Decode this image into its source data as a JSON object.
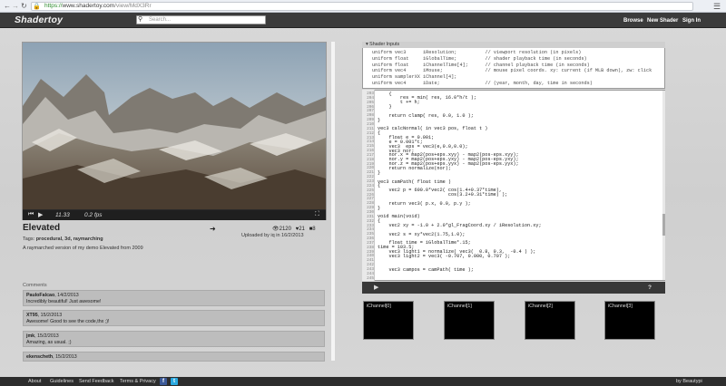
{
  "browser": {
    "url_secure": "https://",
    "url_host": "www.shadertoy.com",
    "url_path": "/view/MdX3Rr"
  },
  "header": {
    "logo": "Shadertoy",
    "search_placeholder": "Search...",
    "links": [
      "Browse",
      "New Shader",
      "Sign In"
    ]
  },
  "player": {
    "time": "11.33",
    "fps": "0.2 fps"
  },
  "shader": {
    "title": "Elevated",
    "views": "2120",
    "likes": "21",
    "comments_count": "8",
    "tags_label": "Tags:",
    "tags": "procedural, 3d, raymarching",
    "uploaded": "Uploaded by iq in 16/2/2013",
    "description": "A raymarched version of my demo Elevated from 2009"
  },
  "comments": {
    "label": "Comments",
    "items": [
      {
        "user": "PauloFalcao",
        "date": "14/2/2013",
        "text": "Incredibly beautiful! Just awesome!"
      },
      {
        "user": "XT95",
        "date": "15/2/2013",
        "text": "Awesome! Good to see the code,thx ;)!"
      },
      {
        "user": "jmk",
        "date": "15/2/2013",
        "text": "Amazing, as usual. ;)"
      },
      {
        "user": "ekenscheth",
        "date": "15/2/2013",
        "text": ""
      }
    ]
  },
  "inputs": {
    "title": "Shader Inputs",
    "lines": [
      "uniform vec3      iResolution;          // viewport resolution (in pixels)",
      "uniform float     iGlobalTime;          // shader playback time (in seconds)",
      "uniform float     iChannelTime[4];      // channel playback time (in seconds)",
      "uniform vec4      iMouse;               // mouse pixel coords. xy: current (if MLB down), zw: click",
      "uniform samplerXX iChannel[4];",
      "uniform vec4      iDate;                // (year, month, day, time in seconds)"
    ]
  },
  "editor": {
    "line_numbers": [
      "203",
      "204",
      "205",
      "206",
      "207",
      "208",
      "209",
      "210",
      "211",
      "212",
      "213",
      "214",
      "215",
      "216",
      "217",
      "218",
      "219",
      "220",
      "221",
      "222",
      "223",
      "224",
      "225",
      "226",
      "227",
      "228",
      "229",
      "230",
      "231",
      "232",
      "233",
      "234",
      "235",
      "236",
      "237",
      "238",
      "239",
      "240",
      "241",
      "242",
      "243",
      "244",
      "245"
    ],
    "code": [
      "    {",
      "        res = min( res, 16.0*h/t );",
      "        t += h;",
      "    }",
      "",
      "    return clamp( res, 0.0, 1.0 );",
      "}",
      "",
      "vec3 calcNormal( in vec3 pos, float t )",
      "{",
      "    float e = 0.001;",
      "    e = 0.001*t;",
      "    vec3  eps = vec3(e,0.0,0.0);",
      "    vec3 nor;",
      "    nor.x = map2(pos+eps.xyy) - map2(pos-eps.xyy);",
      "    nor.y = map2(pos+eps.yxy) - map2(pos-eps.yxy);",
      "    nor.z = map2(pos+eps.yyx) - map2(pos-eps.yyx);",
      "    return normalize(nor);",
      "}",
      "",
      "vec3 camPath( float time )",
      "{",
      "    vec2 p = 600.0*vec2( cos(1.4+0.37*time),",
      "                         cos(3.2+0.31*time) );",
      "",
      "    return vec3( p.x, 0.0, p.y );",
      "}",
      "",
      "void main(void)",
      "{",
      "    vec2 xy = -1.0 + 2.0*gl_FragCoord.xy / iResolution.xy;",
      "",
      "    vec2 s = xy*vec2(1.75,1.0);",
      "",
      "    float time = iGlobalTime*.15;",
      "time = 103.5;",
      "    vec3 light1 = normalize( vec3(  0.8, 0.3,  -0.4 ) );",
      "    vec3 light2 = vec3( -0.707, 0.000, 0.707 );",
      "",
      "",
      "    vec3 campos = camPath( time );",
      "",
      ""
    ],
    "help": "?"
  },
  "channels": [
    "iChannel[0]",
    "iChannel[1]",
    "iChannel[2]",
    "iChannel[3]"
  ],
  "footer": {
    "links": [
      "About",
      "Guidelines",
      "Send Feedback",
      "Terms & Privacy"
    ],
    "credit": "by Beautypi"
  },
  "icons": {
    "facebook": "facebook-icon",
    "twitter": "twitter-icon",
    "share": "share-icon",
    "views": "eye-icon",
    "likes": "heart-icon",
    "comments": "comment-icon"
  },
  "colors": {
    "header": "#3b3b3b",
    "background": "#d3d3d3",
    "footer": "#2d2d2d"
  }
}
